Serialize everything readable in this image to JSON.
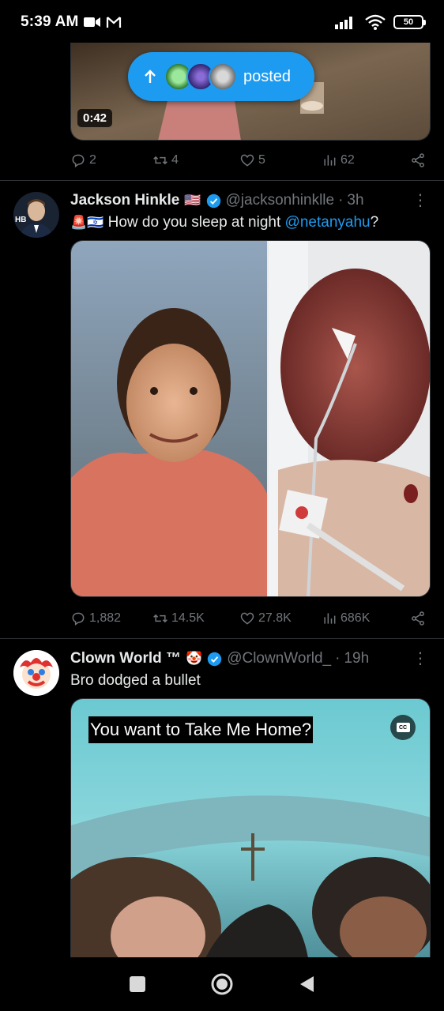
{
  "status_bar": {
    "time": "5:39 AM",
    "battery": "50",
    "left_icons": [
      "video-camera-icon",
      "gmail-icon"
    ],
    "right_icons": [
      "signal-icon",
      "wifi-icon",
      "battery-icon"
    ]
  },
  "posted_pill": {
    "label": "posted",
    "arrow": "up-arrow-icon"
  },
  "tweet1": {
    "video_duration": "0:42",
    "actions": {
      "replies": "2",
      "retweets": "4",
      "likes": "5",
      "views": "62"
    }
  },
  "tweet2": {
    "display_name": "Jackson Hinkle",
    "flag": "🇺🇸",
    "handle": "@jacksonhinklle",
    "time_sep": "·",
    "time": "3h",
    "text_prefix_emojis": "🚨🇮🇱",
    "text_main": " How do you sleep at night ",
    "mention": "@netanyahu",
    "text_suffix": "?",
    "actions": {
      "replies": "1,882",
      "retweets": "14.5K",
      "likes": "27.8K",
      "views": "686K"
    }
  },
  "tweet3": {
    "display_name": "Clown World ™",
    "clown_emoji": "🤡",
    "handle": "@ClownWorld_",
    "time_sep": "·",
    "time": "19h",
    "text": "Bro dodged a bullet",
    "caption": "You want to Take Me Home?",
    "cc_label": "CC"
  },
  "colors": {
    "accent": "#1d9bf0",
    "muted": "#71767b",
    "background": "#000000",
    "divider": "#2f3336"
  }
}
